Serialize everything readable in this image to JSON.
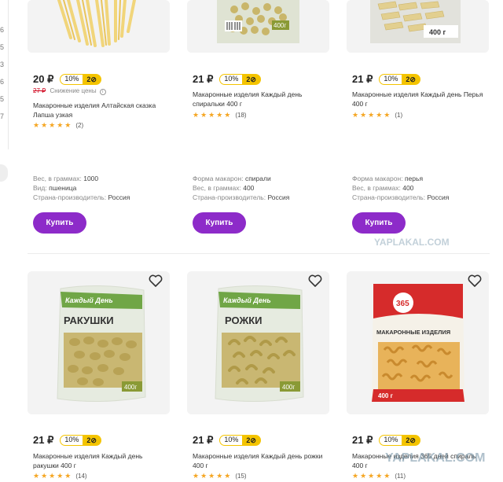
{
  "left_rail": {
    "numbers": [
      "6",
      "5",
      "3",
      "6",
      "5",
      "7"
    ]
  },
  "currency": "₽",
  "badge": {
    "discount": "10%",
    "bonus": "2"
  },
  "buy_label": "Купить",
  "products": [
    {
      "price": "20 ₽",
      "old_price": "27 ₽",
      "price_drop_label": "Снижение цены",
      "title": "Макаронные изделия Алтайская сказка Лапша узкая",
      "rating": "★★★★★",
      "reviews": "(2)",
      "specs": [
        {
          "key": "Вес, в граммах:",
          "value": "1000"
        },
        {
          "key": "Вид:",
          "value": "пшеница"
        },
        {
          "key": "Страна-производитель:",
          "value": "Россия"
        }
      ],
      "pack_weight": "",
      "image": "pasta-nests-image"
    },
    {
      "price": "21 ₽",
      "title": "Макаронные изделия Каждый день спиральки 400 г",
      "rating": "★★★★★",
      "reviews": "(18)",
      "specs": [
        {
          "key": "Форма макарон:",
          "value": "спирали"
        },
        {
          "key": "Вес, в граммах:",
          "value": "400"
        },
        {
          "key": "Страна-производитель:",
          "value": "Россия"
        }
      ],
      "pack_weight": "400г"
    },
    {
      "price": "21 ₽",
      "title": "Макаронные изделия Каждый день Перья 400 г",
      "rating": "★★★★★",
      "reviews": "(1)",
      "specs": [
        {
          "key": "Форма макарон:",
          "value": "перья"
        },
        {
          "key": "Вес, в граммах:",
          "value": "400"
        },
        {
          "key": "Страна-производитель:",
          "value": "Россия"
        }
      ],
      "pack_weight": "400 г"
    },
    {
      "price": "21 ₽",
      "title": "Макаронные изделия Каждый день ракушки 400 г",
      "rating": "★★★★★",
      "reviews": "(14)",
      "pack_brand": "Каждый День",
      "pack_name": "РАКУШКИ",
      "pack_weight": "400г"
    },
    {
      "price": "21 ₽",
      "title": "Макаронные изделия Каждый день рожки 400 г",
      "rating": "★★★★★",
      "reviews": "(15)",
      "pack_brand": "Каждый День",
      "pack_name": "РОЖКИ",
      "pack_weight": "400г"
    },
    {
      "price": "21 ₽",
      "title": "Макаронные изделия 365 дней спираль 400 г",
      "rating": "★★★★★",
      "reviews": "(11)",
      "pack_brand": "365",
      "pack_name": "МАКАРОННЫЕ ИЗДЕЛИЯ",
      "pack_weight": "400 г"
    }
  ],
  "watermark": "YAPLAKAL.COM",
  "colors": {
    "buy_button": "#8d2bc9",
    "stars": "#f5a623",
    "badge_yellow": "#f4c400",
    "old_price": "#d0021b"
  }
}
